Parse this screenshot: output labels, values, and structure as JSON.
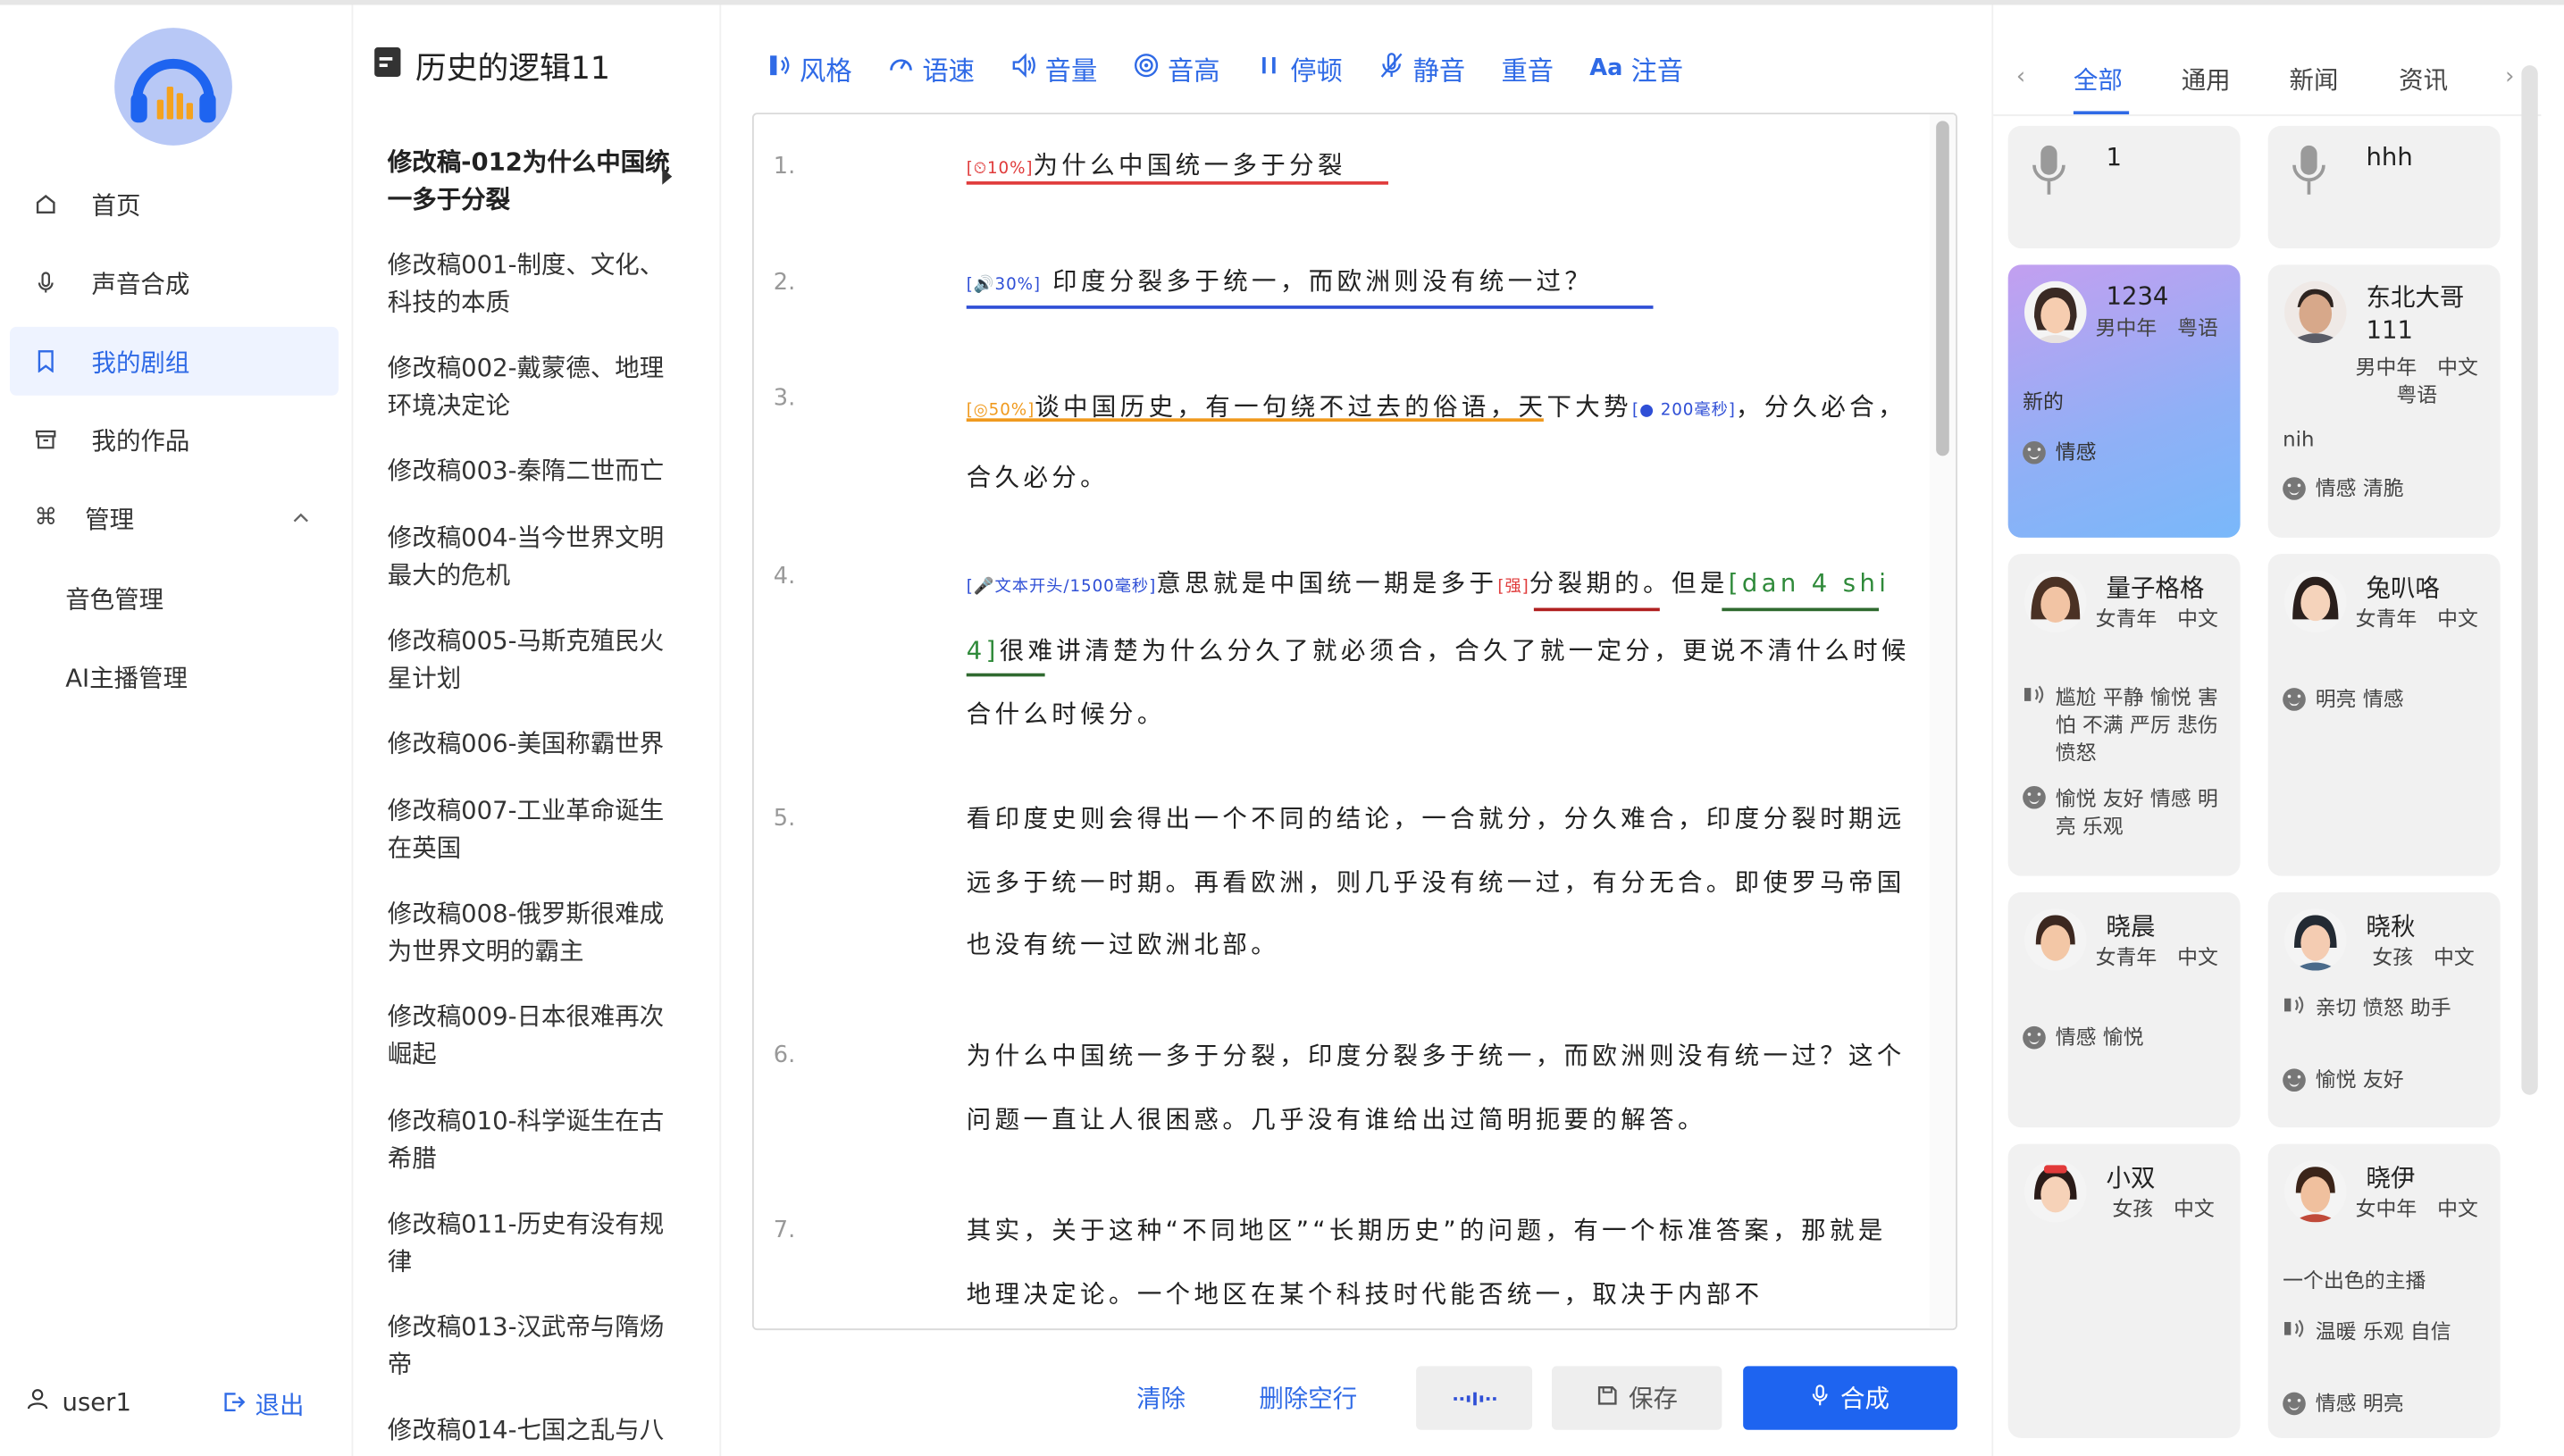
{
  "sidebar": {
    "nav": [
      {
        "label": "首页"
      },
      {
        "label": "声音合成"
      },
      {
        "label": "我的剧组"
      },
      {
        "label": "我的作品"
      },
      {
        "label": "管理"
      }
    ],
    "sub": [
      {
        "label": "音色管理"
      },
      {
        "label": "AI主播管理"
      }
    ],
    "user": "user1",
    "logout": "退出"
  },
  "list": {
    "title": "历史的逻辑11",
    "items": [
      "修改稿-012为什么中国统一多于分裂",
      "修改稿001-制度、文化、科技的本质",
      "修改稿002-戴蒙德、地理环境决定论",
      "修改稿003-秦隋二世而亡",
      "修改稿004-当今世界文明最大的危机",
      "修改稿005-马斯克殖民火星计划",
      "修改稿006-美国称霸世界",
      "修改稿007-工业革命诞生在英国",
      "修改稿008-俄罗斯很难成为世界文明的霸主",
      "修改稿009-日本很难再次崛起",
      "修改稿010-科学诞生在古希腊",
      "修改稿011-历史有没有规律",
      "修改稿013-汉武帝与隋炀帝",
      "修改稿014-七国之乱与八"
    ]
  },
  "toolbar": {
    "style": "风格",
    "speed": "语速",
    "volume": "音量",
    "pitch": "音高",
    "pause": "停顿",
    "mute": "静音",
    "stress": "重音",
    "phonetic": "注音"
  },
  "editor": {
    "p1": {
      "num": "1.",
      "tag": "[⏲10%]",
      "text": "为什么中国统一多于分裂"
    },
    "p2": {
      "num": "2.",
      "tag": "[🔊30%]",
      "text": "印度分裂多于统一，而欧洲则没有统一过？"
    },
    "p3": {
      "num": "3.",
      "tag": "[◎50%]",
      "a": "谈中国历史，有一句绕不过去的俗语，天下大势",
      "tag2": "[● 200毫秒]",
      "b": "，分久必合，合久必分。"
    },
    "p4": {
      "num": "4.",
      "tag": "[🎤文本开头/1500毫秒]",
      "a": "意思就是中国统一期是多于",
      "tag2": "[强]",
      "b": "分裂期的。但是",
      "c": "[dan 4 shi 4]",
      "d": "很难讲清楚为什么分久了就必须合，合久了就一定分，更说不清什么时候合什么时候分。"
    },
    "p5": {
      "num": "5.",
      "text": "看印度史则会得出一个不同的结论，一合就分，分久难合，印度分裂时期远远多于统一时期。再看欧洲，则几乎没有统一过，有分无合。即使罗马帝国也没有统一过欧洲北部。"
    },
    "p6": {
      "num": "6.",
      "text": "为什么中国统一多于分裂，印度分裂多于统一，而欧洲则没有统一过？这个问题一直让人很困惑。几乎没有谁给出过简明扼要的解答。"
    },
    "p7": {
      "num": "7.",
      "text": "其实，关于这种“不同地区”“长期历史”的问题，有一个标准答案，那就是地理决定论。一个地区在某个科技时代能否统一，取决于内部不"
    }
  },
  "actions": {
    "clear": "清除",
    "delete_blank": "删除空行",
    "save": "保存",
    "synth": "合成"
  },
  "tabs": [
    "全部",
    "通用",
    "新闻",
    "资讯"
  ],
  "cards": [
    {
      "name": "1"
    },
    {
      "name": "hhh"
    },
    {
      "name": "1234",
      "meta": "男中年　粤语",
      "desc": "新的",
      "tags": "情感"
    },
    {
      "name": "东北大哥111",
      "meta": "男中年　中文 粤语",
      "desc": "nih",
      "tags": "情感 清脆"
    },
    {
      "name": "量子格格",
      "meta": "女青年　中文",
      "style": "尴尬 平静 愉悦 害怕 不满 严厉 悲伤 愤怒",
      "tags": "愉悦 友好 情感 明亮 乐观"
    },
    {
      "name": "兔叭咯",
      "meta": "女青年　中文",
      "tags": "明亮 情感"
    },
    {
      "name": "晓晨",
      "meta": "女青年　中文",
      "tags": "情感 愉悦"
    },
    {
      "name": "晓秋",
      "meta": "女孩　中文",
      "style": "亲切 愤怒 助手",
      "tags": "愉悦 友好"
    },
    {
      "name": "小双",
      "meta": "女孩　中文"
    },
    {
      "name": "晓伊",
      "meta": "女中年　中文",
      "desc": "一个出色的主播",
      "style": "温暖 乐观 自信",
      "tags": "情感 明亮"
    }
  ],
  "colors": {
    "accent": "#2f6ae6",
    "primary_button": "#1e64f0",
    "speed_tag": "#e03b3b",
    "volume_tag": "#2f4fd6",
    "pitch_tag": "#f09a1e",
    "phonetic_tag": "#2f8a3a"
  }
}
